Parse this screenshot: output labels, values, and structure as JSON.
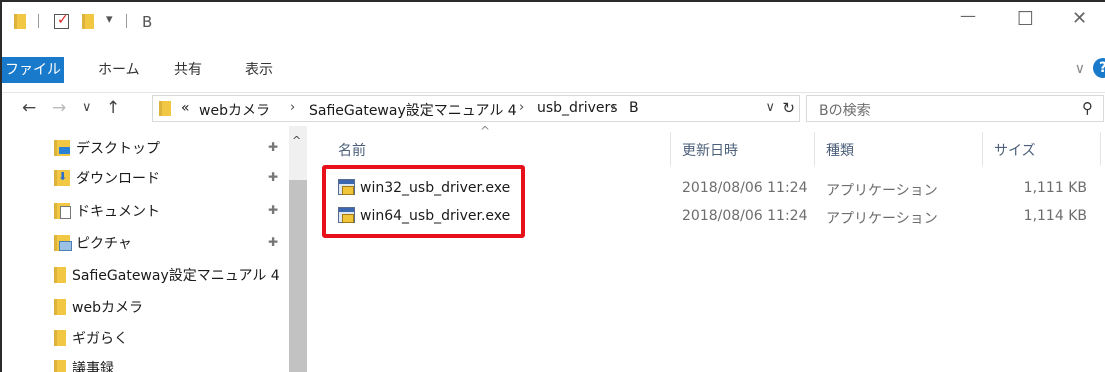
{
  "titlebar": {
    "title": "B",
    "quick_access_dropdown": "▾",
    "minimize": "—",
    "maximize": "☐",
    "close": "✕"
  },
  "ribbon": {
    "tabs": [
      "ファイル",
      "ホーム",
      "共有",
      "表示"
    ],
    "collapse": "∨",
    "help": "?"
  },
  "address": {
    "back": "←",
    "forward": "→",
    "recent": "∨",
    "up": "↑",
    "overflow": "«",
    "crumbs": [
      "webカメラ",
      "SafieGateway設定マニュアル 4",
      "usb_drivers",
      "B"
    ],
    "crumb_sep": "›",
    "dropdown": "∨",
    "refresh": "↻"
  },
  "search": {
    "placeholder": "Bの検索",
    "icon": "⚲"
  },
  "navpane": {
    "items": [
      {
        "label": "デスクトップ",
        "icon": "desktop-folder-icon",
        "pinned": true
      },
      {
        "label": "ダウンロード",
        "icon": "download-folder-icon",
        "pinned": true
      },
      {
        "label": "ドキュメント",
        "icon": "documents-folder-icon",
        "pinned": true
      },
      {
        "label": "ピクチャ",
        "icon": "pictures-folder-icon",
        "pinned": true
      },
      {
        "label": "SafieGateway設定マニュアル 4",
        "icon": "folder-icon",
        "pinned": false
      },
      {
        "label": "webカメラ",
        "icon": "folder-icon",
        "pinned": false
      },
      {
        "label": "ギガらく",
        "icon": "folder-icon",
        "pinned": false
      },
      {
        "label": "議事録",
        "icon": "folder-icon",
        "pinned": false
      }
    ],
    "pin_glyph": "📌",
    "scroll_up": "^"
  },
  "filelist": {
    "columns": [
      "名前",
      "更新日時",
      "種類",
      "サイズ"
    ],
    "sort_indicator": "^",
    "rows": [
      {
        "name": "win32_usb_driver.exe",
        "modified": "2018/08/06 11:24",
        "type": "アプリケーション",
        "size": "1,111 KB"
      },
      {
        "name": "win64_usb_driver.exe",
        "modified": "2018/08/06 11:24",
        "type": "アプリケーション",
        "size": "1,114 KB"
      }
    ]
  },
  "colors": {
    "accent": "#1979ca",
    "highlight_box": "#e8101a",
    "folder": "#f2c744"
  }
}
